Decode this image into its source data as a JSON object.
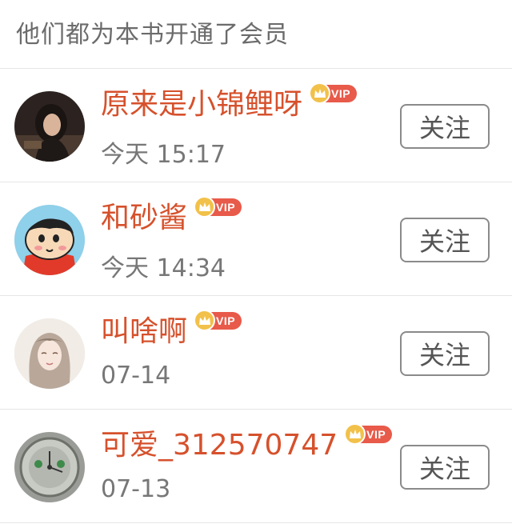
{
  "header": {
    "title": "他们都为本书开通了会员"
  },
  "badge": {
    "vip_label": "VIP",
    "vip_color": "#e85a4a",
    "crown_color": "#f2c14a",
    "icon": "crown-icon"
  },
  "accent_color": "#d6512c",
  "members": [
    {
      "name": "原来是小锦鲤呀",
      "time": "今天 15:17",
      "follow_label": "关注",
      "avatar": "avatar-photo-dark"
    },
    {
      "name": "和砂酱",
      "time": "今天 14:34",
      "follow_label": "关注",
      "avatar": "avatar-cartoon-boy"
    },
    {
      "name": "叫啥啊",
      "time": "07-14",
      "follow_label": "关注",
      "avatar": "avatar-illustrated-girl"
    },
    {
      "name": "可爱_312570747",
      "time": "07-13",
      "follow_label": "关注",
      "avatar": "avatar-clock-photo"
    }
  ]
}
